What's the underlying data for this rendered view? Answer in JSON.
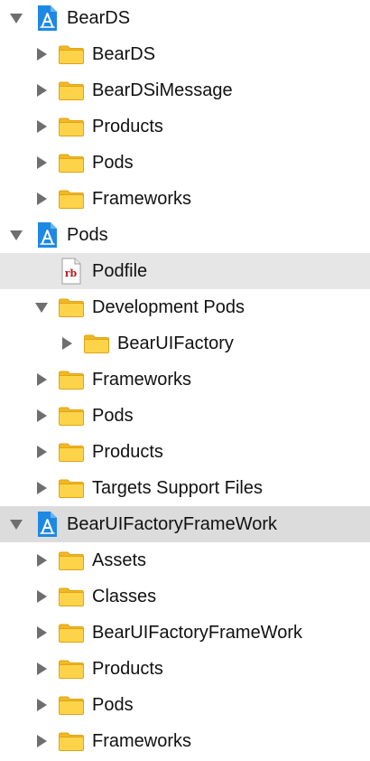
{
  "tree": [
    {
      "label": "BearDS",
      "level": 0,
      "icon": "xcode-project-icon",
      "state": "expanded",
      "name": "project-beards",
      "selection": ""
    },
    {
      "label": "BearDS",
      "level": 1,
      "icon": "folder-icon",
      "state": "collapsed",
      "name": "group-beards",
      "selection": ""
    },
    {
      "label": "BearDSiMessage",
      "level": 1,
      "icon": "folder-icon",
      "state": "collapsed",
      "name": "group-beardsimessage",
      "selection": ""
    },
    {
      "label": "Products",
      "level": 1,
      "icon": "folder-icon",
      "state": "collapsed",
      "name": "group-products",
      "selection": ""
    },
    {
      "label": "Pods",
      "level": 1,
      "icon": "folder-icon",
      "state": "collapsed",
      "name": "group-pods",
      "selection": ""
    },
    {
      "label": "Frameworks",
      "level": 1,
      "icon": "folder-icon",
      "state": "collapsed",
      "name": "group-frameworks",
      "selection": ""
    },
    {
      "label": "Pods",
      "level": 0,
      "icon": "xcode-project-icon",
      "state": "expanded",
      "name": "project-pods",
      "selection": ""
    },
    {
      "label": "Podfile",
      "level": 1,
      "icon": "ruby-file-icon",
      "state": "none",
      "name": "file-podfile",
      "selection": "light"
    },
    {
      "label": "Development Pods",
      "level": 1,
      "icon": "folder-icon",
      "state": "expanded",
      "name": "group-development-pods",
      "selection": ""
    },
    {
      "label": "BearUIFactory",
      "level": 2,
      "icon": "folder-icon",
      "state": "collapsed",
      "name": "group-bearuifactory",
      "selection": ""
    },
    {
      "label": "Frameworks",
      "level": 1,
      "icon": "folder-icon",
      "state": "collapsed",
      "name": "group-frameworks",
      "selection": ""
    },
    {
      "label": "Pods",
      "level": 1,
      "icon": "folder-icon",
      "state": "collapsed",
      "name": "group-pods",
      "selection": ""
    },
    {
      "label": "Products",
      "level": 1,
      "icon": "folder-icon",
      "state": "collapsed",
      "name": "group-products",
      "selection": ""
    },
    {
      "label": "Targets Support Files",
      "level": 1,
      "icon": "folder-icon",
      "state": "collapsed",
      "name": "group-targets-support-files",
      "selection": ""
    },
    {
      "label": "BearUIFactoryFrameWork",
      "level": 0,
      "icon": "xcode-project-icon",
      "state": "expanded",
      "name": "project-bearuifactoryframework",
      "selection": "strong"
    },
    {
      "label": "Assets",
      "level": 1,
      "icon": "folder-icon",
      "state": "collapsed",
      "name": "group-assets",
      "selection": ""
    },
    {
      "label": "Classes",
      "level": 1,
      "icon": "folder-icon",
      "state": "collapsed",
      "name": "group-classes",
      "selection": ""
    },
    {
      "label": "BearUIFactoryFrameWork",
      "level": 1,
      "icon": "folder-icon",
      "state": "collapsed",
      "name": "group-bearuifactoryframework",
      "selection": ""
    },
    {
      "label": "Products",
      "level": 1,
      "icon": "folder-icon",
      "state": "collapsed",
      "name": "group-products",
      "selection": ""
    },
    {
      "label": "Pods",
      "level": 1,
      "icon": "folder-icon",
      "state": "collapsed",
      "name": "group-pods",
      "selection": ""
    },
    {
      "label": "Frameworks",
      "level": 1,
      "icon": "folder-icon",
      "state": "collapsed",
      "name": "group-frameworks",
      "selection": ""
    }
  ],
  "colors": {
    "folder_fill": "#fdd34a",
    "folder_tab": "#f2b821",
    "folder_stroke": "#e0a416",
    "project_blue": "#1e88e5",
    "project_blue_light": "#64b5f6",
    "disclosure": "#6e6e6e",
    "ruby_red": "#b71c1c",
    "selection_strong": "#dcdcdc",
    "selection_light": "#e6e6e6"
  }
}
